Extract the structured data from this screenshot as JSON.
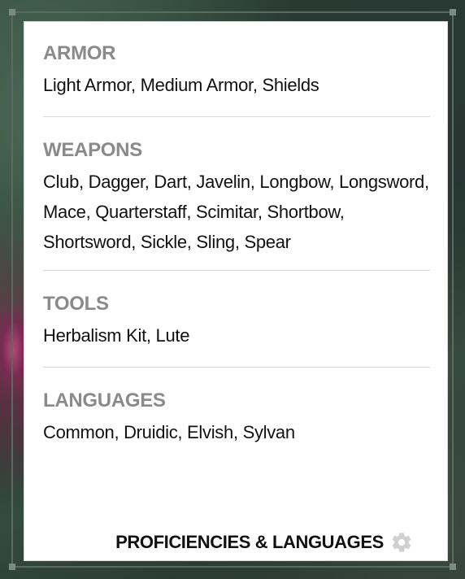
{
  "sections": [
    {
      "title": "ARMOR",
      "value": "Light Armor, Medium Armor, Shields"
    },
    {
      "title": "WEAPONS",
      "value": "Club, Dagger, Dart, Javelin, Longbow, Longsword, Mace, Quarterstaff, Scimitar, Shortbow, Shortsword, Sickle, Sling, Spear"
    },
    {
      "title": "TOOLS",
      "value": "Herbalism Kit, Lute"
    },
    {
      "title": "LANGUAGES",
      "value": "Common, Druidic, Elvish, Sylvan"
    }
  ],
  "footer": {
    "label": "PROFICIENCIES & LANGUAGES",
    "settings_icon": "gear-icon"
  },
  "colors": {
    "section_title": "#8a8a8a",
    "text": "#111111",
    "divider": "#d9d9d9",
    "panel_bg": "#ffffff",
    "gear": "#d0d0d0"
  }
}
